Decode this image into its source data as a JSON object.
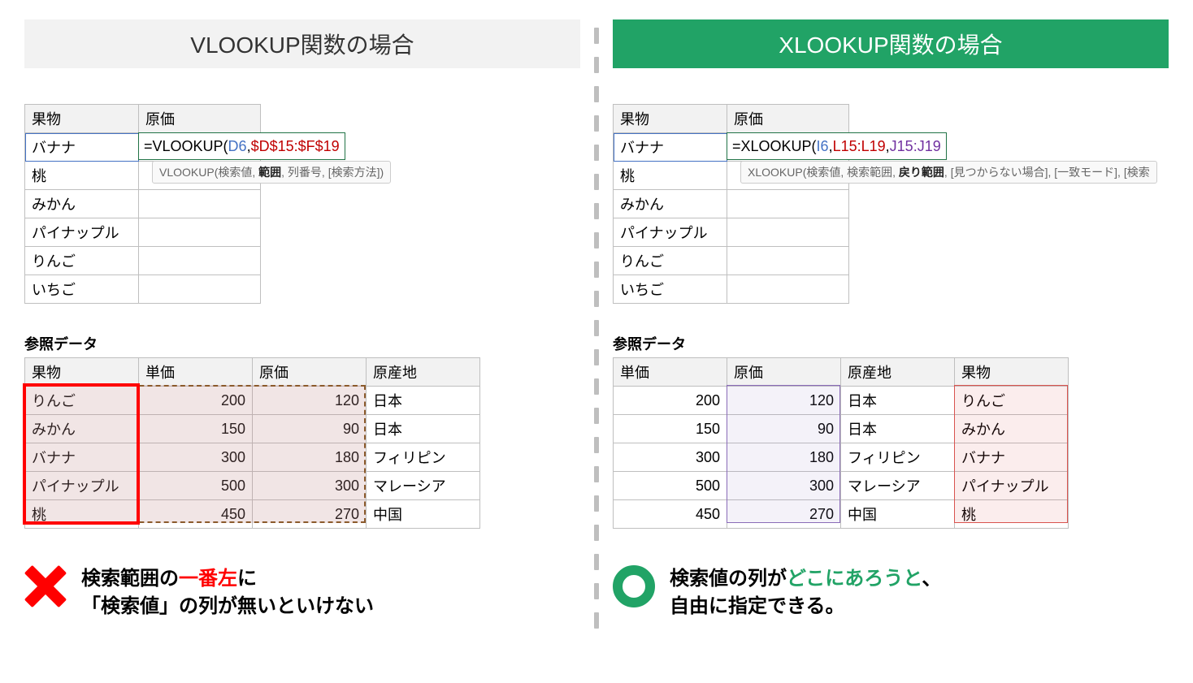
{
  "left": {
    "title": "VLOOKUP関数の場合",
    "top_headers": {
      "fruit": "果物",
      "cost": "原価"
    },
    "fruits": [
      "バナナ",
      "桃",
      "みかん",
      "パイナップル",
      "りんご",
      "いちご"
    ],
    "formula": {
      "eq": "=",
      "fn": "VLOOKUP(",
      "arg1": "D6",
      "comma1": ",",
      "arg2": "$D$15:$F$19"
    },
    "tooltip": {
      "open": "VLOOKUP(",
      "a1": "検索値, ",
      "bold": "範囲",
      "rest": ", 列番号, [検索方法])"
    },
    "ref_label": "参照データ",
    "ref_headers": [
      "果物",
      "単価",
      "原価",
      "原産地"
    ],
    "ref_rows": [
      {
        "fruit": "りんご",
        "price": 200,
        "cost": 120,
        "origin": "日本"
      },
      {
        "fruit": "みかん",
        "price": 150,
        "cost": 90,
        "origin": "日本"
      },
      {
        "fruit": "バナナ",
        "price": 300,
        "cost": 180,
        "origin": "フィリピン"
      },
      {
        "fruit": "パイナップル",
        "price": 500,
        "cost": 300,
        "origin": "マレーシア"
      },
      {
        "fruit": "桃",
        "price": 450,
        "cost": 270,
        "origin": "中国"
      }
    ],
    "summary": {
      "l1a": "検索範囲の",
      "l1b": "一番左",
      "l1c": "に",
      "l2": "「検索値」の列が無いといけない"
    }
  },
  "right": {
    "title": "XLOOKUP関数の場合",
    "top_headers": {
      "fruit": "果物",
      "cost": "原価"
    },
    "fruits": [
      "バナナ",
      "桃",
      "みかん",
      "パイナップル",
      "りんご",
      "いちご"
    ],
    "formula": {
      "eq": "=",
      "fn": "XLOOKUP(",
      "arg1": "I6",
      "comma1": ",",
      "arg2": "L15:L19",
      "comma2": ",",
      "arg3": "J15:J19"
    },
    "tooltip": {
      "open": "XLOOKUP(",
      "a1": "検索値, 検索範囲, ",
      "bold": "戻り範囲",
      "rest": ", [見つからない場合], [一致モード], [検索"
    },
    "ref_label": "参照データ",
    "ref_headers": [
      "単価",
      "原価",
      "原産地",
      "果物"
    ],
    "ref_rows": [
      {
        "price": 200,
        "cost": 120,
        "origin": "日本",
        "fruit": "りんご"
      },
      {
        "price": 150,
        "cost": 90,
        "origin": "日本",
        "fruit": "みかん"
      },
      {
        "price": 300,
        "cost": 180,
        "origin": "フィリピン",
        "fruit": "バナナ"
      },
      {
        "price": 500,
        "cost": 300,
        "origin": "マレーシア",
        "fruit": "パイナップル"
      },
      {
        "price": 450,
        "cost": 270,
        "origin": "中国",
        "fruit": "桃"
      }
    ],
    "summary": {
      "l1a": "検索値の列が",
      "l1b": "どこにあろうと",
      "l1c": "、",
      "l2": "自由に指定できる。"
    }
  }
}
